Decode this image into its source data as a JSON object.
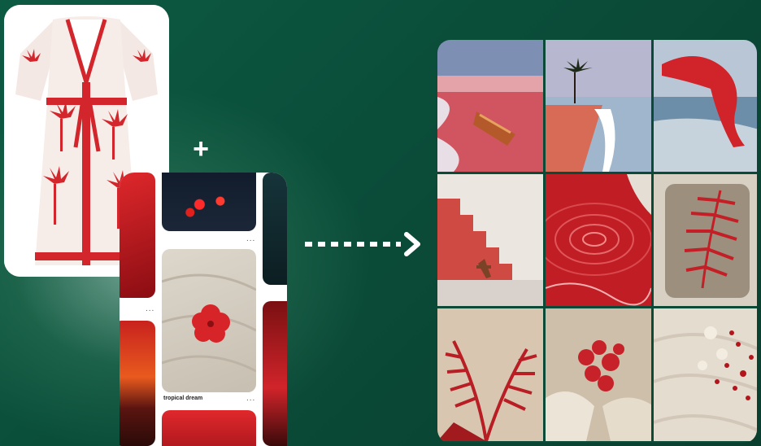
{
  "board": {
    "caption": "tropical dream",
    "more_label": "..."
  },
  "plus_symbol": "+",
  "grid_images": [
    "pink-lagoon-boat",
    "palm-beach-sunset",
    "red-scarf-ocean",
    "red-stairs-wall",
    "red-water-ripples",
    "palm-leaf-fossil-stone",
    "red-palm-fronds",
    "red-coral-rocks",
    "sand-shells-red-beads"
  ],
  "colors": {
    "background": "#0b4e3a",
    "accent_red": "#d0242a"
  }
}
